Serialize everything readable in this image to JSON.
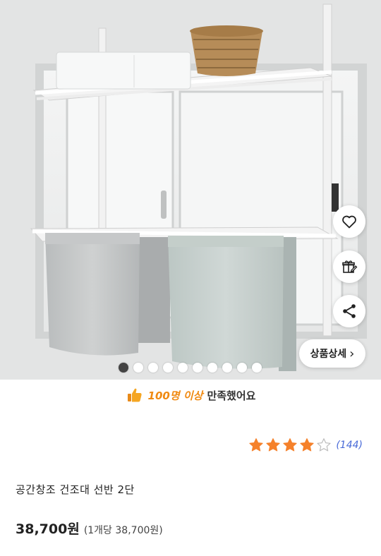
{
  "hero": {
    "dots_total": 10,
    "dots_active_index": 0,
    "detail_button_label": "상품상세",
    "detail_chevron": "›",
    "icons": [
      "heart-icon",
      "gift-edit-icon",
      "share-icon"
    ]
  },
  "satisfaction": {
    "icon": "thumbs-up-icon",
    "count": "100명 이상",
    "text": "만족했어요"
  },
  "rating": {
    "stars_filled": 4,
    "stars_total": 5,
    "review_count": "(144)",
    "star_color": "#f5812b"
  },
  "product": {
    "title": "공간창조 건조대 선반 2단",
    "price": "38,700원",
    "unit_price": "(1개당 38,700원)"
  },
  "colors": {
    "accent_orange": "#f08a12",
    "review_blue": "#4a6bd8"
  }
}
